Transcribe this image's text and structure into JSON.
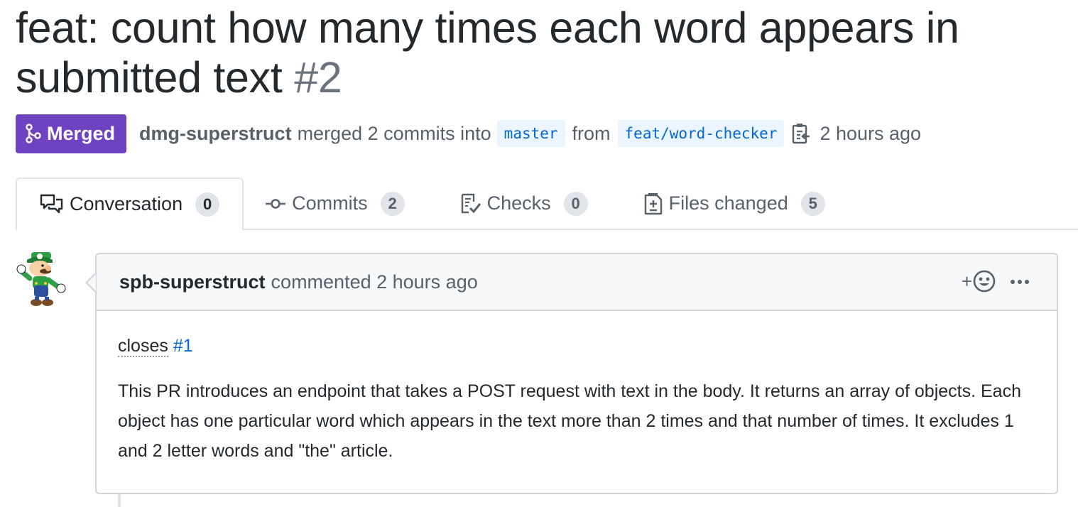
{
  "pull_request": {
    "title": "feat: count how many times each word appears in submitted text",
    "number": "#2",
    "state_label": "Merged",
    "state_color": "#6f42c1",
    "author": "dmg-superstruct",
    "merge_text": "merged 2 commits into",
    "base_branch": "master",
    "from_text": "from",
    "head_branch": "feat/word-checker",
    "time_ago": "2 hours ago"
  },
  "tabs": [
    {
      "label": "Conversation",
      "count": "0",
      "icon": "comment-discussion-icon",
      "selected": true
    },
    {
      "label": "Commits",
      "count": "2",
      "icon": "git-commit-icon",
      "selected": false
    },
    {
      "label": "Checks",
      "count": "0",
      "icon": "checklist-icon",
      "selected": false
    },
    {
      "label": "Files changed",
      "count": "5",
      "icon": "file-diff-icon",
      "selected": false
    }
  ],
  "comment": {
    "author": "spb-superstruct",
    "action": "commented 2 hours ago",
    "reaction_plus": "+",
    "closes_word": "closes",
    "closes_ref": "#1",
    "body": "This PR introduces an endpoint that takes a POST request with text in the body. It returns an array of objects. Each object has one particular word which appears in the text more than 2 times and that number of times. It excludes 1 and 2 letter words and \"the\" article."
  }
}
